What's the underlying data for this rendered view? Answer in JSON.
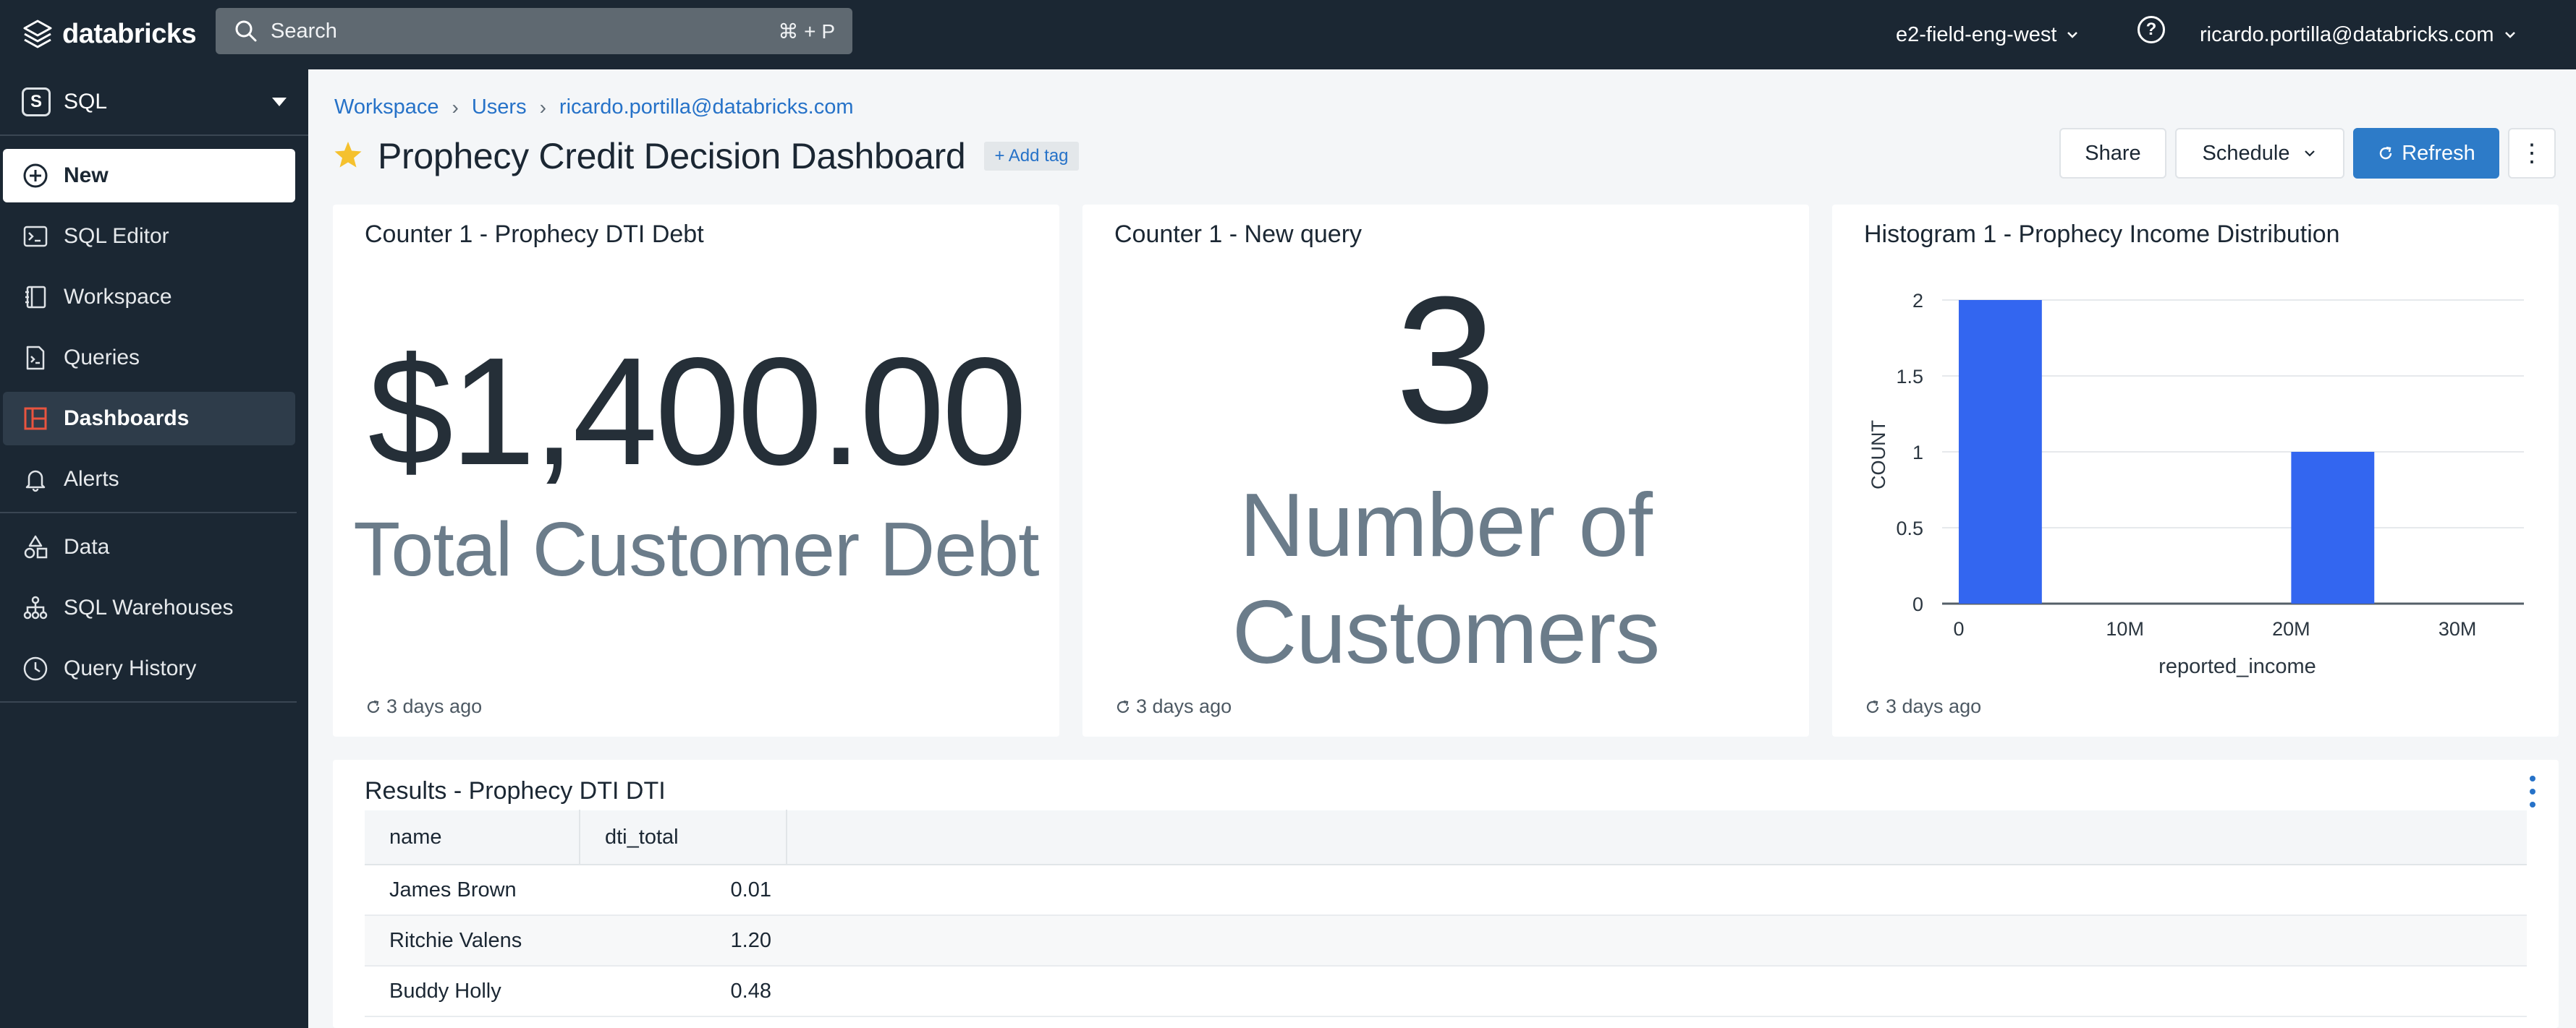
{
  "topbar": {
    "brand": "databricks",
    "search_placeholder": "Search",
    "search_shortcut": "⌘ + P",
    "workspace": "e2-field-eng-west",
    "user": "ricardo.portilla@databricks.com"
  },
  "sidebar": {
    "persona_badge": "S",
    "persona": "SQL",
    "new_label": "New",
    "items": [
      {
        "label": "SQL Editor",
        "icon": "terminal-icon"
      },
      {
        "label": "Workspace",
        "icon": "notebook-icon"
      },
      {
        "label": "Queries",
        "icon": "query-icon"
      },
      {
        "label": "Dashboards",
        "icon": "dashboard-icon",
        "active": true
      },
      {
        "label": "Alerts",
        "icon": "bell-icon"
      },
      {
        "label": "Data",
        "icon": "shapes-icon"
      },
      {
        "label": "SQL Warehouses",
        "icon": "warehouse-icon"
      },
      {
        "label": "Query History",
        "icon": "clock-icon"
      }
    ]
  },
  "breadcrumb": [
    "Workspace",
    "Users",
    "ricardo.portilla@databricks.com"
  ],
  "page": {
    "title": "Prophecy Credit Decision Dashboard",
    "add_tag": "+ Add tag",
    "favorited": true
  },
  "actions": {
    "share": "Share",
    "schedule": "Schedule",
    "refresh": "Refresh"
  },
  "widgets": {
    "debt": {
      "title": "Counter 1 - Prophecy DTI Debt",
      "value": "$1,400.00",
      "label": "Total Customer Debt",
      "updated": "3 days ago"
    },
    "customers": {
      "title": "Counter 1 - New query",
      "value": "3",
      "label": "Number of Customers",
      "updated": "3 days ago"
    },
    "histogram": {
      "title": "Histogram 1 - Prophecy Income Distribution",
      "updated": "3 days ago"
    },
    "results": {
      "title": "Results - Prophecy DTI DTI",
      "columns": [
        "name",
        "dti_total"
      ],
      "rows": [
        {
          "name": "James Brown",
          "dti_total": "0.01"
        },
        {
          "name": "Ritchie Valens",
          "dti_total": "1.20"
        },
        {
          "name": "Buddy Holly",
          "dti_total": "0.48"
        }
      ]
    }
  },
  "colors": {
    "bar": "#3366f0",
    "accent": "#2d7bc8",
    "star": "#f5c12e",
    "dashboards_icon": "#e8543f"
  },
  "chart_data": {
    "type": "bar",
    "title": "Histogram 1 - Prophecy Income Distribution",
    "xlabel": "reported_income",
    "ylabel": "COUNT",
    "x_ticks": [
      "0",
      "10M",
      "20M",
      "30M"
    ],
    "y_ticks": [
      "0",
      "0.5",
      "1",
      "1.5",
      "2"
    ],
    "xlim": [
      -1000000,
      34000000
    ],
    "ylim": [
      0,
      2
    ],
    "bins": [
      {
        "x_start": 0,
        "x_end": 5000000,
        "count": 2
      },
      {
        "x_start": 20000000,
        "x_end": 25000000,
        "count": 1
      }
    ],
    "grid": true
  }
}
